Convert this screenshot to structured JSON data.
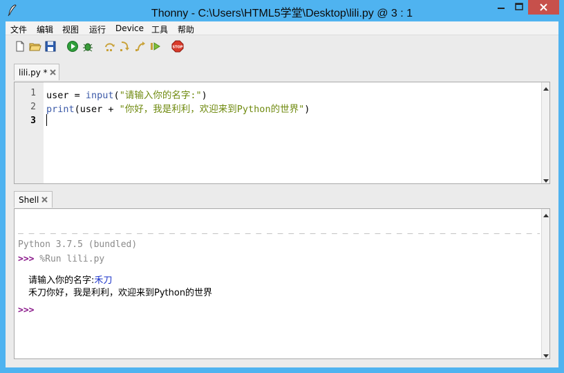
{
  "window": {
    "title": "Thonny  -  C:\\Users\\HTML5学堂\\Desktop\\lili.py  @  3 : 1",
    "accent": "#4fb3f0",
    "close_color": "#c7504b"
  },
  "menu": {
    "items": [
      "文件",
      "编辑",
      "视图",
      "运行",
      "Device",
      "工具",
      "帮助"
    ]
  },
  "toolbar": {
    "icons": [
      "new-file-icon",
      "open-folder-icon",
      "save-icon",
      "run-icon",
      "debug-icon",
      "step-over-icon",
      "step-into-icon",
      "step-out-icon",
      "resume-icon",
      "stop-icon"
    ],
    "stop_label": "STOP"
  },
  "editor": {
    "tab_label": "lili.py *",
    "lines": [
      {
        "no": "1",
        "parts": [
          {
            "t": "user = ",
            "c": ""
          },
          {
            "t": "input",
            "c": "kw"
          },
          {
            "t": "(",
            "c": ""
          },
          {
            "t": "\"请输入你的名字:\"",
            "c": "str"
          },
          {
            "t": ")",
            "c": ""
          }
        ]
      },
      {
        "no": "2",
        "parts": [
          {
            "t": "print",
            "c": "kw"
          },
          {
            "t": "(user + ",
            "c": ""
          },
          {
            "t": "\"你好，我是利利，欢迎来到Python的世界\"",
            "c": "str"
          },
          {
            "t": ")",
            "c": ""
          }
        ]
      },
      {
        "no": "3",
        "parts": []
      }
    ],
    "current_line": "3"
  },
  "shell": {
    "tab_label": "Shell",
    "dashes": "_ _ _ _ _ _ _ _ _ _ _ _ _ _ _ _ _ _ _ _ _ _ _ _ _ _ _ _ _ _ _ _ _ _ _ _ _ _ _ _ _ _ _ _ _ _ _ _ _ _ _ _ _ _ _ _ _ _ _ _ _ _",
    "version": "Python 3.7.5 (bundled)",
    "prompt": ">>>",
    "command": " %Run lili.py",
    "output_prompt": "请输入你的名字:",
    "output_input": "禾刀",
    "output_line2": "禾刀你好，我是利利，欢迎来到Python的世界",
    "final_prompt": ">>>"
  }
}
